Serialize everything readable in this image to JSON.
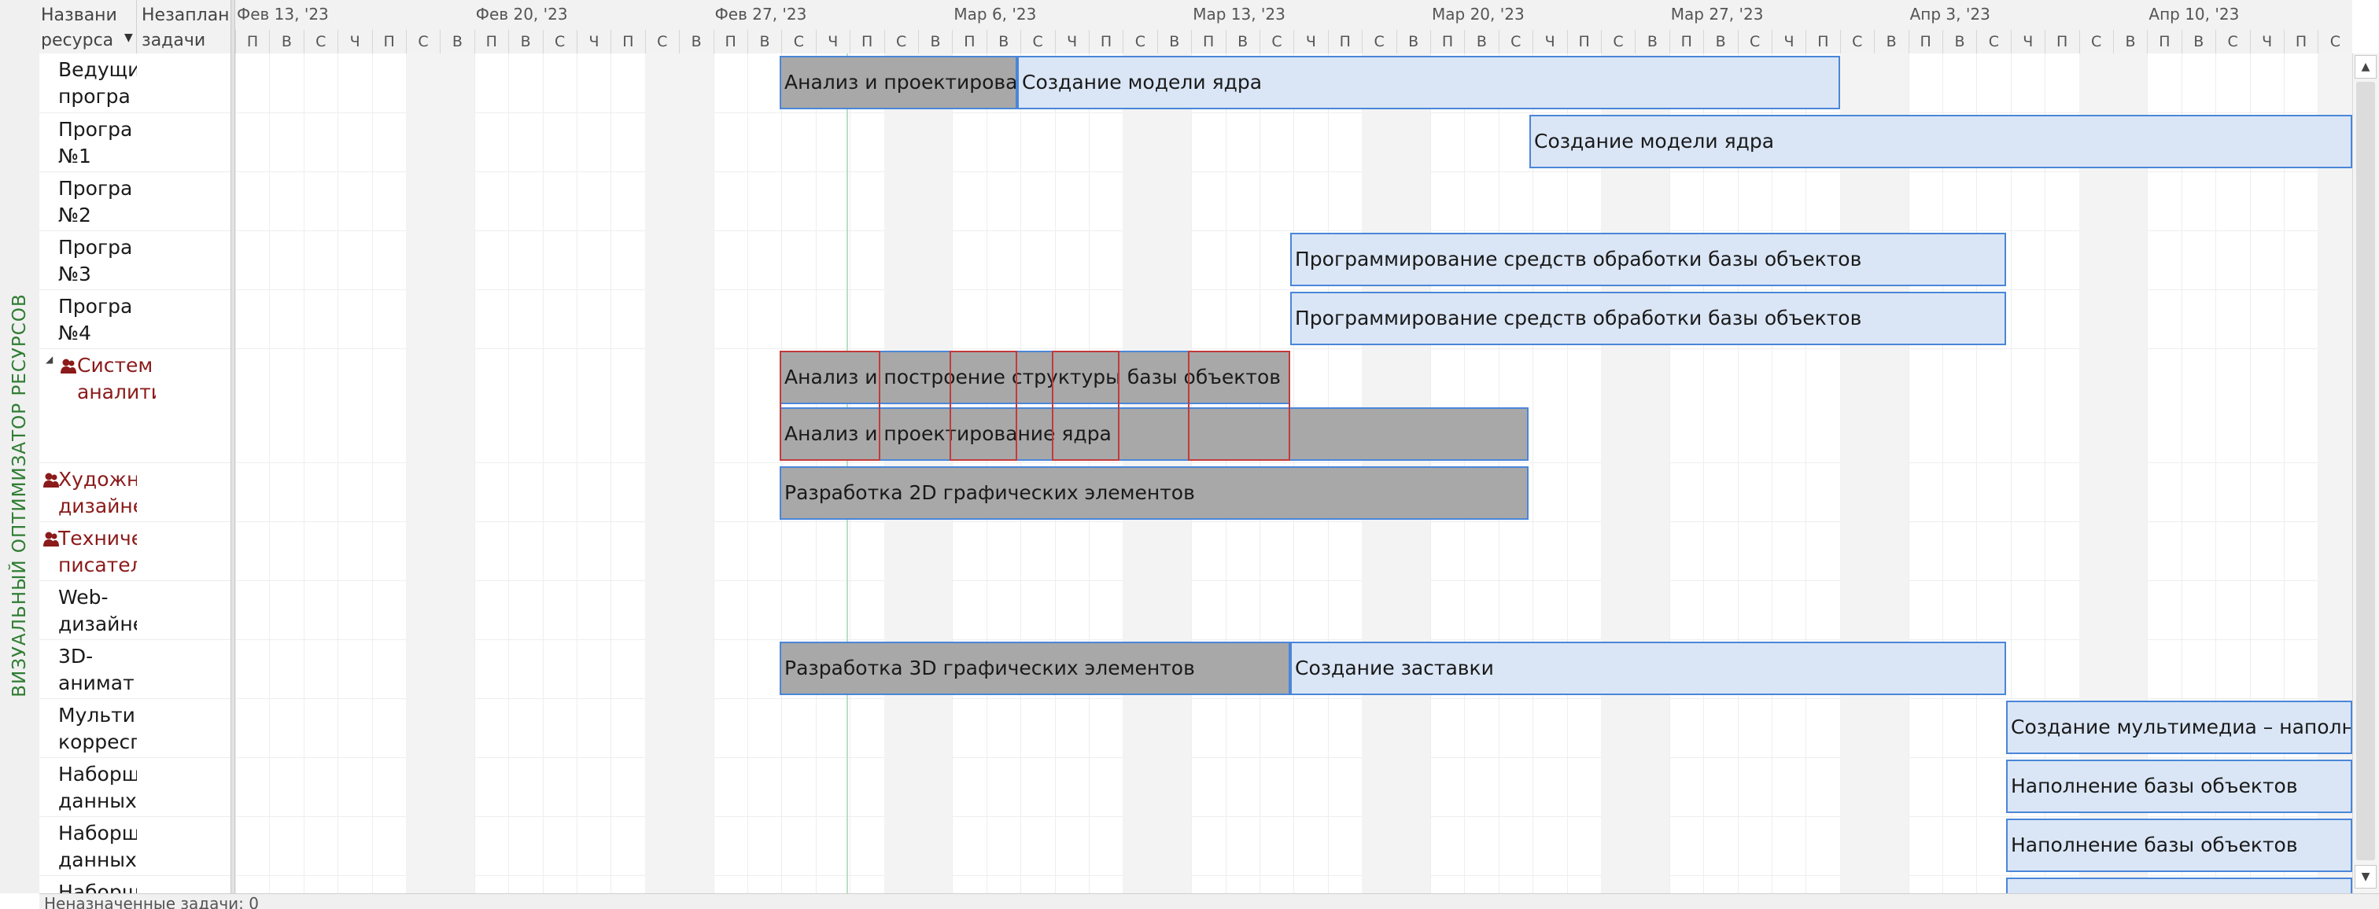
{
  "side_label": "ВИЗУАЛЬНЫЙ ОПТИМИЗАТОР РЕСУРСОВ",
  "columns": {
    "name": "Названи\nресурса",
    "unscheduled": "Незаплан\nзадачи"
  },
  "weeks": [
    "Фев 13, '23",
    "Фев 20, '23",
    "Фев 27, '23",
    "Мар 6, '23",
    "Мар 13, '23",
    "Мар 20, '23",
    "Мар 27, '23",
    "Апр 3, '23",
    "Апр 10, '23"
  ],
  "day_letters": [
    "П",
    "В",
    "С",
    "Ч",
    "П",
    "С",
    "В"
  ],
  "resources": [
    {
      "name": "Ведущи\nпрогра",
      "overallocated": false
    },
    {
      "name": "Програ\n№1",
      "overallocated": false
    },
    {
      "name": "Програ\n№2",
      "overallocated": false
    },
    {
      "name": "Програ\n№3",
      "overallocated": false
    },
    {
      "name": "Програ\n№4",
      "overallocated": false
    },
    {
      "name": "Систем\nаналити",
      "overallocated": true
    },
    {
      "name": "Художн\nдизайне",
      "overallocated": true
    },
    {
      "name": "Техниче\nписател",
      "overallocated": true
    },
    {
      "name": "Web-\nдизайне",
      "overallocated": false
    },
    {
      "name": "3D-\nанимат",
      "overallocated": false
    },
    {
      "name": "Мульти\nкорресп",
      "overallocated": false
    },
    {
      "name": "Наборщ\nданных",
      "overallocated": false
    },
    {
      "name": "Наборщ\nданных",
      "overallocated": false
    },
    {
      "name": "Наборщ",
      "overallocated": false
    }
  ],
  "tasks": [
    {
      "label": "Анализ и проектирование ядра",
      "status": "done"
    },
    {
      "label": "Создание модели ядра",
      "status": "future"
    },
    {
      "label": "Создание модели ядра",
      "status": "future"
    },
    {
      "label": "Программирование средств обработки базы объектов",
      "status": "future"
    },
    {
      "label": "Программирование средств обработки базы объектов",
      "status": "future"
    },
    {
      "label": "Анализ и построение структуры базы объектов",
      "status": "done"
    },
    {
      "label": "Анализ и проектирование ядра",
      "status": "done"
    },
    {
      "label": "Разработка 2D графических элементов",
      "status": "done"
    },
    {
      "label": "Разработка 3D графических элементов",
      "status": "done"
    },
    {
      "label": "Создание заставки",
      "status": "future"
    },
    {
      "label": "Создание мультимедиа – наполнение",
      "status": "future"
    },
    {
      "label": "Наполнение базы объектов",
      "status": "future"
    },
    {
      "label": "Наполнение базы объектов",
      "status": "future"
    },
    {
      "label": "",
      "status": "future"
    }
  ],
  "status_text": "Неназначенные задачи: 0",
  "colors": {
    "done": "#a8a8a8",
    "future": "#dae6f6",
    "bar_border": "#4a86d8",
    "overallocated": "#8b1a1a",
    "side_label": "#2f7d32"
  }
}
